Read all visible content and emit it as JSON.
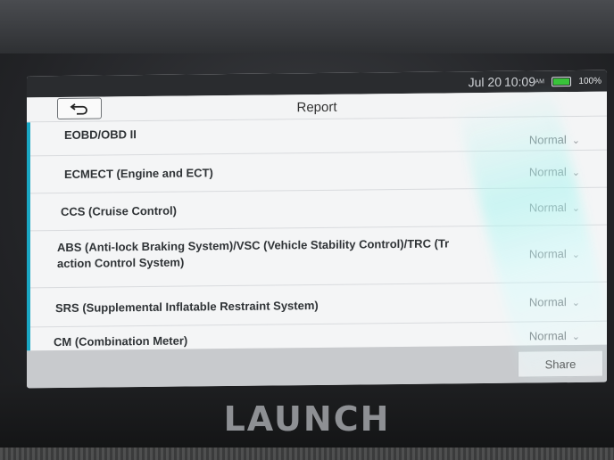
{
  "status_bar": {
    "date": "Jul 20",
    "time": "10:09",
    "ampm": "AM",
    "battery": "100%",
    "battery_level": 1.0,
    "battery_color": "#39c43a"
  },
  "header": {
    "title": "Report",
    "back_icon": "back-arrow-icon"
  },
  "report": {
    "rows": [
      {
        "label": "EOBD/OBD II",
        "status": "Normal"
      },
      {
        "label": "ECMECT (Engine and ECT)",
        "status": "Normal"
      },
      {
        "label": "CCS (Cruise Control)",
        "status": "Normal"
      },
      {
        "label_line1": "ABS (Anti-lock Braking System)/VSC (Vehicle Stability Control)/TRC (Tr",
        "label_line2": "action Control System)",
        "status": "Normal"
      },
      {
        "label": "SRS (Supplemental Inflatable Restraint System)",
        "status": "Normal"
      },
      {
        "label": "CM (Combination Meter)",
        "status": "Normal"
      }
    ]
  },
  "footer": {
    "share_label": "Share"
  },
  "device": {
    "brand": "LAUNCH",
    "accent_color": "#1aa7c4"
  }
}
